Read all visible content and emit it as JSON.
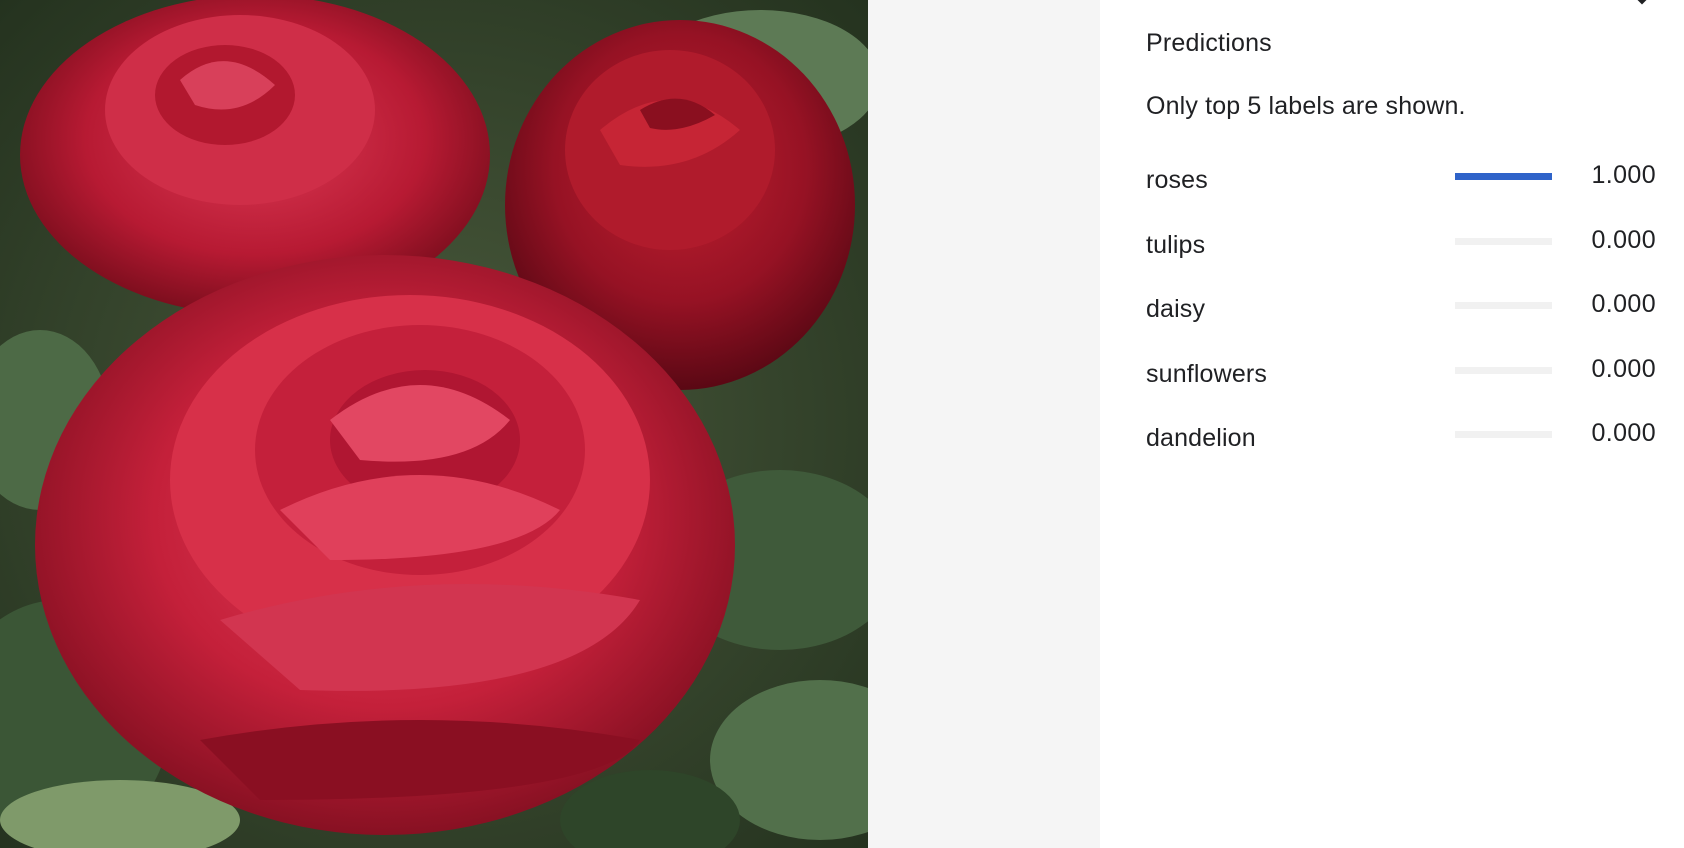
{
  "panel": {
    "title": "Predictions",
    "note": "Only top 5 labels are shown.",
    "close_icon": "close-icon"
  },
  "predictions": [
    {
      "label": "roses",
      "value": "1.000",
      "score": 1.0
    },
    {
      "label": "tulips",
      "value": "0.000",
      "score": 0.0
    },
    {
      "label": "daisy",
      "value": "0.000",
      "score": 0.0
    },
    {
      "label": "sunflowers",
      "value": "0.000",
      "score": 0.0
    },
    {
      "label": "dandelion",
      "value": "0.000",
      "score": 0.0
    }
  ],
  "colors": {
    "bar_fill": "#2f63c9",
    "bar_track": "#f1f1f1",
    "viewer_bg": "#f5f5f5"
  }
}
